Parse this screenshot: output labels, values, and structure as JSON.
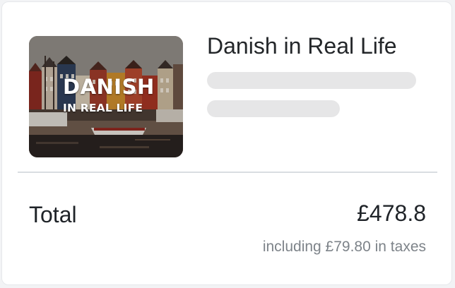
{
  "product": {
    "title": "Danish in Real Life",
    "image": {
      "overlay_line1": "DANISH",
      "overlay_line2": "IN REAL LIFE",
      "alt": "Nyhavn harbor colorful houses"
    },
    "placeholder_lines": 2
  },
  "summary": {
    "total_label": "Total",
    "total_amount": "£478.8",
    "tax_note": "including £79.80 in taxes"
  },
  "colors": {
    "text_primary": "#1f2328",
    "text_secondary": "#7d8389",
    "skeleton": "#e6e6e7",
    "divider": "#d9dde1"
  }
}
